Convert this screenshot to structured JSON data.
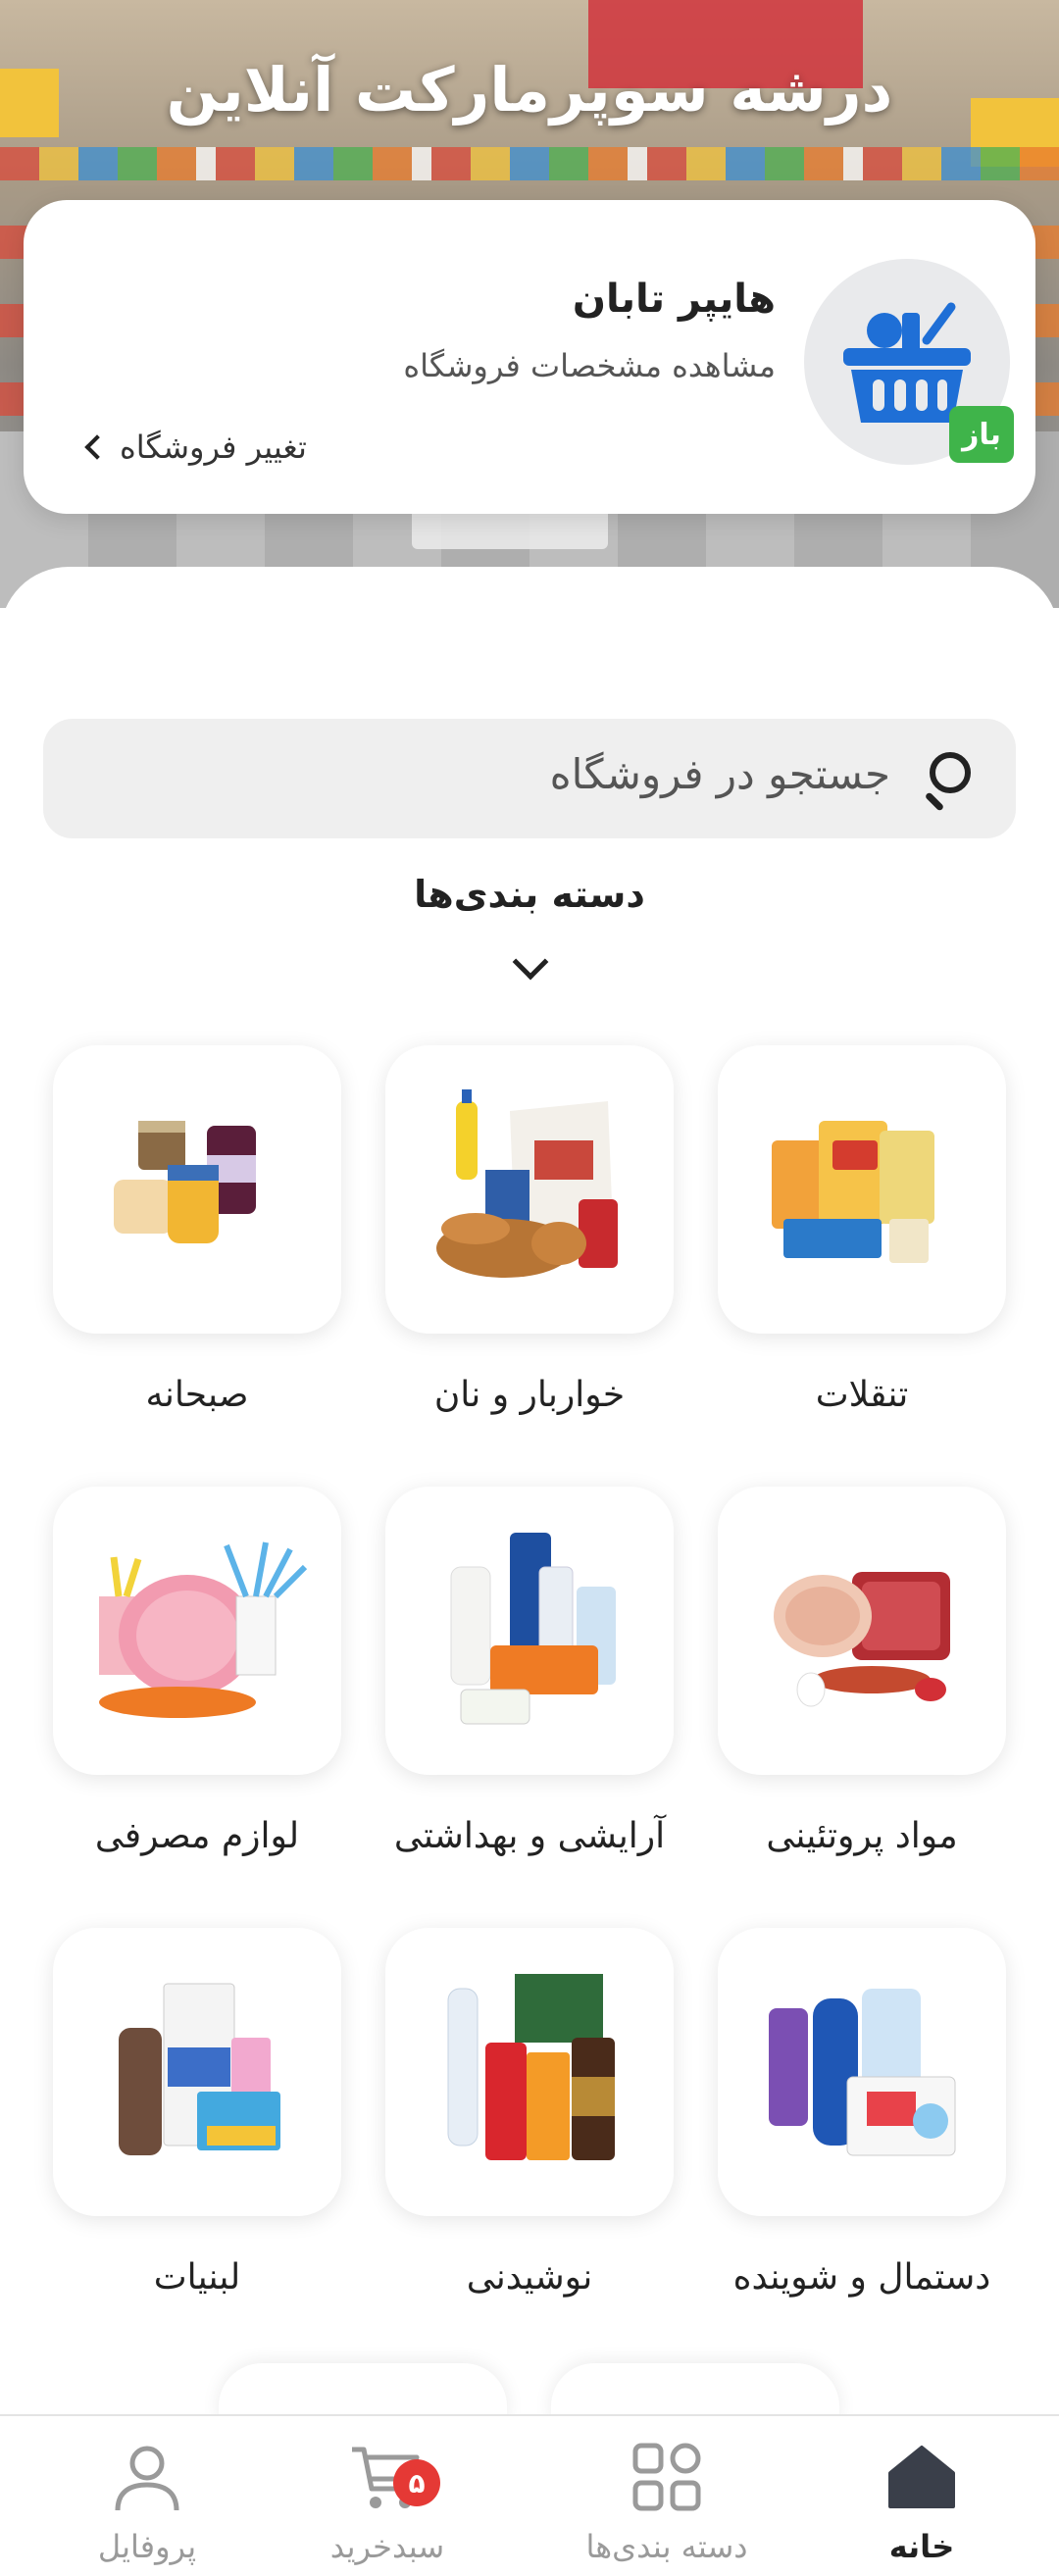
{
  "hero": {
    "title": "درشه سوپرمارکت آنلاین"
  },
  "store": {
    "name": "هایپر تابان",
    "details_link": "مشاهده مشخصات فروشگاه",
    "change_link": "تغییر فروشگاه",
    "status_badge": "باز",
    "status_color": "#3fb44a"
  },
  "search": {
    "placeholder": "جستجو در فروشگاه"
  },
  "categories_section": {
    "title": "دسته بندی‌ها"
  },
  "categories": [
    {
      "label": "تنقلات",
      "icon": "snacks-image"
    },
    {
      "label": "خواربار و نان",
      "icon": "groceries-bread-image"
    },
    {
      "label": "صبحانه",
      "icon": "breakfast-image"
    },
    {
      "label": "مواد پروتئینی",
      "icon": "protein-image"
    },
    {
      "label": "آرایشی و بهداشتی",
      "icon": "cosmetics-hygiene-image"
    },
    {
      "label": "لوازم مصرفی",
      "icon": "disposables-image"
    },
    {
      "label": "دستمال و شوینده",
      "icon": "tissues-detergents-image"
    },
    {
      "label": "نوشیدنی",
      "icon": "beverages-image"
    },
    {
      "label": "لبنیات",
      "icon": "dairy-image"
    }
  ],
  "bottom_nav": {
    "home": "خانه",
    "categories": "دسته بندی‌ها",
    "cart": "سبدخرید",
    "cart_count": "۵",
    "profile": "پروفایل"
  },
  "colors": {
    "accent": "#3fb44a",
    "badge": "#e53935",
    "logo_blue": "#1f6fd6"
  }
}
